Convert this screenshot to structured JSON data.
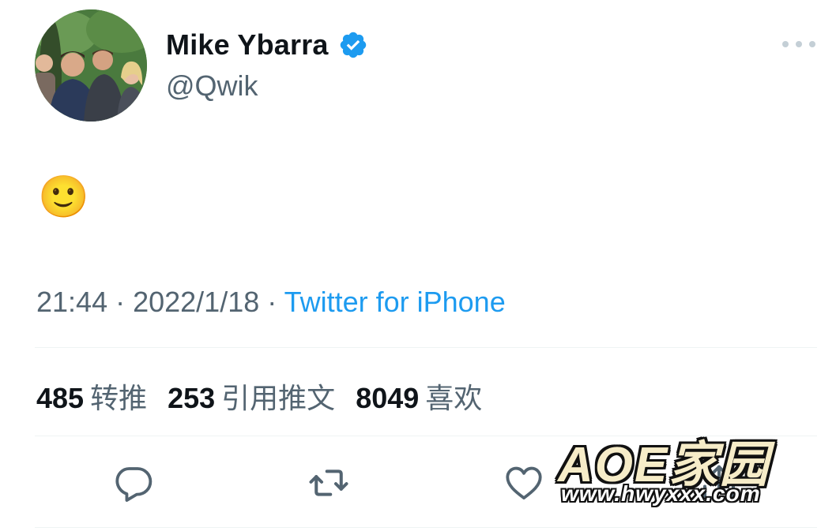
{
  "author": {
    "name": "Mike Ybarra",
    "handle": "@Qwik",
    "verified_icon": "verified-badge-icon",
    "verified_color": "#1d9bf0"
  },
  "tweet": {
    "text": "🙂"
  },
  "meta": {
    "time": "21:44",
    "separator1": " · ",
    "date": "2022/1/18",
    "separator2": " · ",
    "source": "Twitter for iPhone"
  },
  "stats": [
    {
      "count": "485",
      "label": "转推"
    },
    {
      "count": "253",
      "label": "引用推文"
    },
    {
      "count": "8049",
      "label": "喜欢"
    }
  ],
  "actions": [
    {
      "name": "reply",
      "icon": "reply-icon"
    },
    {
      "name": "retweet",
      "icon": "retweet-icon"
    },
    {
      "name": "like",
      "icon": "heart-icon"
    },
    {
      "name": "share",
      "icon": "share-icon"
    }
  ],
  "watermark": {
    "title": "AOE家园",
    "url": "www.hwyxxx.com"
  },
  "colors": {
    "link": "#1d9bf0",
    "secondary_text": "#536471",
    "primary_text": "#0f1419",
    "divider": "#eff3f4"
  }
}
